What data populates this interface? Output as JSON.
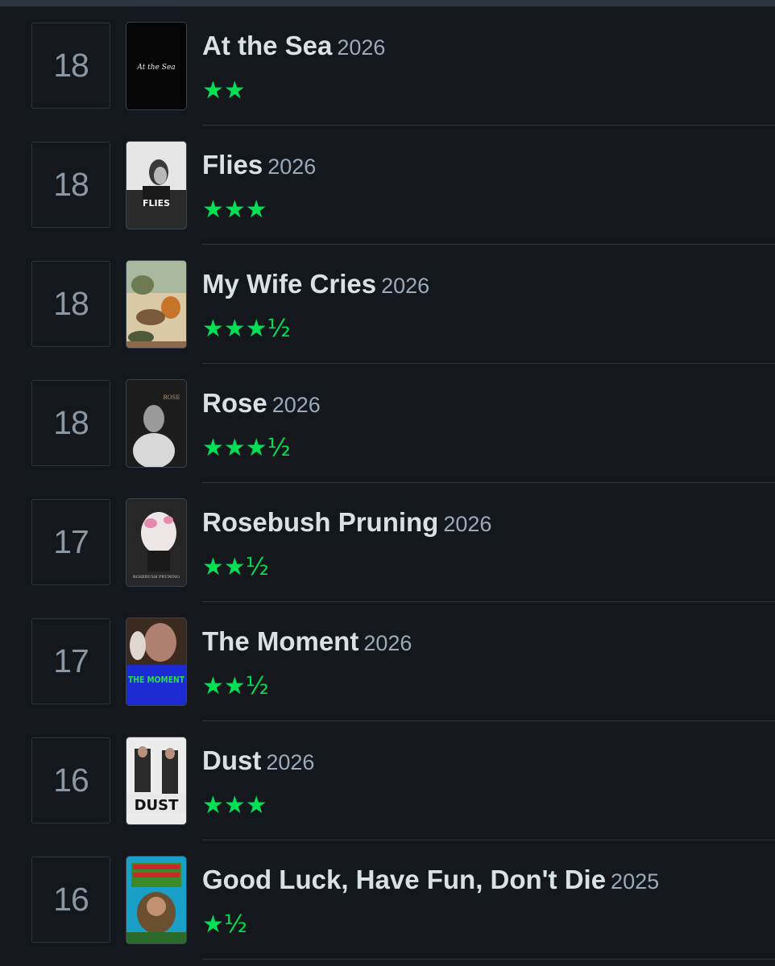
{
  "films": [
    {
      "rank": "18",
      "title": "At the Sea",
      "year": "2026",
      "rating": "★★",
      "poster_text": "At the Sea"
    },
    {
      "rank": "18",
      "title": "Flies",
      "year": "2026",
      "rating": "★★★",
      "poster_text": "FLIES"
    },
    {
      "rank": "18",
      "title": "My Wife Cries",
      "year": "2026",
      "rating": "★★★½",
      "poster_text": ""
    },
    {
      "rank": "18",
      "title": "Rose",
      "year": "2026",
      "rating": "★★★½",
      "poster_text": "ROSE"
    },
    {
      "rank": "17",
      "title": "Rosebush Pruning",
      "year": "2026",
      "rating": "★★½",
      "poster_text": "ROSEBUSH PRUNING"
    },
    {
      "rank": "17",
      "title": "The Moment",
      "year": "2026",
      "rating": "★★½",
      "poster_text": "THE MOMENT"
    },
    {
      "rank": "16",
      "title": "Dust",
      "year": "2026",
      "rating": "★★★",
      "poster_text": "DUST"
    },
    {
      "rank": "16",
      "title": "Good Luck, Have Fun, Don't Die",
      "year": "2025",
      "rating": "★½",
      "poster_text": ""
    }
  ],
  "colors": {
    "background": "#14181c",
    "star": "#00e054",
    "title": "#d8e0e8",
    "year": "#99aabb",
    "rank": "#8a97a5",
    "border": "#2c3440"
  }
}
